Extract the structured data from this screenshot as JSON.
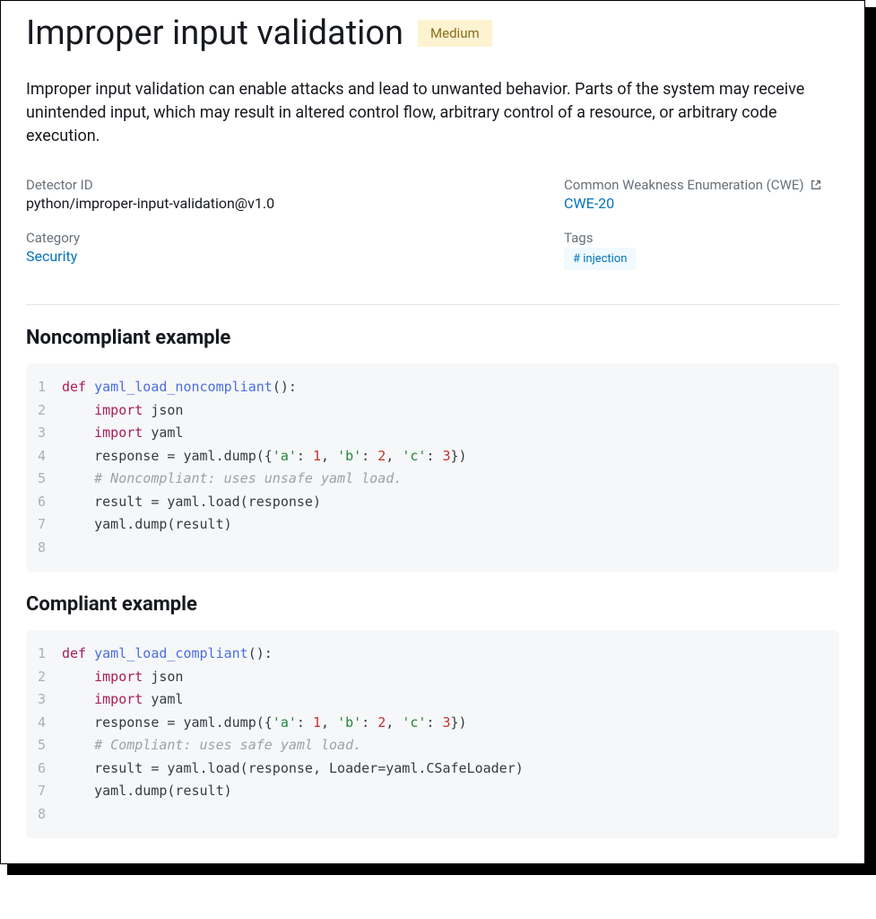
{
  "title": "Improper input validation",
  "severity": "Medium",
  "description": "Improper input validation can enable attacks and lead to unwanted behavior. Parts of the system may receive unintended input, which may result in altered control flow, arbitrary control of a resource, or arbitrary code execution.",
  "meta": {
    "detector_id_label": "Detector ID",
    "detector_id": "python/improper-input-validation@v1.0",
    "category_label": "Category",
    "category": "Security",
    "cwe_label": "Common Weakness Enumeration (CWE)",
    "cwe_link": "CWE-20",
    "tags_label": "Tags",
    "tags": [
      "# injection"
    ]
  },
  "examples": {
    "noncompliant_title": "Noncompliant example",
    "compliant_title": "Compliant example",
    "noncompliant_code": [
      [
        {
          "t": "kw",
          "v": "def "
        },
        {
          "t": "fn",
          "v": "yaml_load_noncompliant"
        },
        {
          "t": "plain",
          "v": "():"
        }
      ],
      [
        {
          "t": "plain",
          "v": "    "
        },
        {
          "t": "kw",
          "v": "import"
        },
        {
          "t": "plain",
          "v": " json"
        }
      ],
      [
        {
          "t": "plain",
          "v": "    "
        },
        {
          "t": "kw",
          "v": "import"
        },
        {
          "t": "plain",
          "v": " yaml"
        }
      ],
      [
        {
          "t": "plain",
          "v": "    response = yaml.dump({"
        },
        {
          "t": "str",
          "v": "'a'"
        },
        {
          "t": "plain",
          "v": ": "
        },
        {
          "t": "num",
          "v": "1"
        },
        {
          "t": "plain",
          "v": ", "
        },
        {
          "t": "str",
          "v": "'b'"
        },
        {
          "t": "plain",
          "v": ": "
        },
        {
          "t": "num",
          "v": "2"
        },
        {
          "t": "plain",
          "v": ", "
        },
        {
          "t": "str",
          "v": "'c'"
        },
        {
          "t": "plain",
          "v": ": "
        },
        {
          "t": "num",
          "v": "3"
        },
        {
          "t": "plain",
          "v": "})"
        }
      ],
      [
        {
          "t": "plain",
          "v": "    "
        },
        {
          "t": "cm",
          "v": "# Noncompliant: uses unsafe yaml load."
        }
      ],
      [
        {
          "t": "plain",
          "v": "    result = yaml.load(response)"
        }
      ],
      [
        {
          "t": "plain",
          "v": "    yaml.dump(result)"
        }
      ],
      [
        {
          "t": "plain",
          "v": ""
        }
      ]
    ],
    "compliant_code": [
      [
        {
          "t": "kw",
          "v": "def "
        },
        {
          "t": "fn",
          "v": "yaml_load_compliant"
        },
        {
          "t": "plain",
          "v": "():"
        }
      ],
      [
        {
          "t": "plain",
          "v": "    "
        },
        {
          "t": "kw",
          "v": "import"
        },
        {
          "t": "plain",
          "v": " json"
        }
      ],
      [
        {
          "t": "plain",
          "v": "    "
        },
        {
          "t": "kw",
          "v": "import"
        },
        {
          "t": "plain",
          "v": " yaml"
        }
      ],
      [
        {
          "t": "plain",
          "v": "    response = yaml.dump({"
        },
        {
          "t": "str",
          "v": "'a'"
        },
        {
          "t": "plain",
          "v": ": "
        },
        {
          "t": "num",
          "v": "1"
        },
        {
          "t": "plain",
          "v": ", "
        },
        {
          "t": "str",
          "v": "'b'"
        },
        {
          "t": "plain",
          "v": ": "
        },
        {
          "t": "num",
          "v": "2"
        },
        {
          "t": "plain",
          "v": ", "
        },
        {
          "t": "str",
          "v": "'c'"
        },
        {
          "t": "plain",
          "v": ": "
        },
        {
          "t": "num",
          "v": "3"
        },
        {
          "t": "plain",
          "v": "})"
        }
      ],
      [
        {
          "t": "plain",
          "v": "    "
        },
        {
          "t": "cm",
          "v": "# Compliant: uses safe yaml load."
        }
      ],
      [
        {
          "t": "plain",
          "v": "    result = yaml.load(response, Loader=yaml.CSafeLoader)"
        }
      ],
      [
        {
          "t": "plain",
          "v": "    yaml.dump(result)"
        }
      ],
      [
        {
          "t": "plain",
          "v": ""
        }
      ]
    ]
  }
}
